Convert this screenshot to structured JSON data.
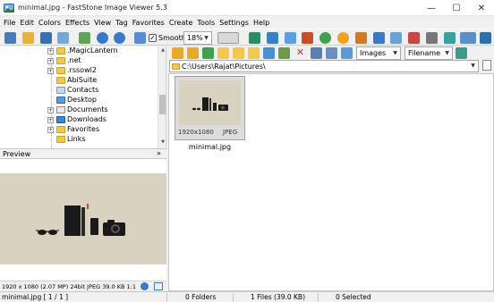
{
  "window": {
    "title": "minimal.jpg - FastStone Image Viewer 5.3",
    "minimize_glyph": "—",
    "maximize_glyph": "☐",
    "close_glyph": "✕"
  },
  "menu": [
    "File",
    "Edit",
    "Colors",
    "Effects",
    "View",
    "Tag",
    "Favorites",
    "Create",
    "Tools",
    "Settings",
    "Help"
  ],
  "toolbar": {
    "smooth_label": "Smooth",
    "smooth_checked": true,
    "zoom_value": "18%"
  },
  "tree": {
    "items": [
      {
        "label": ".MagicLantern",
        "expandable": true
      },
      {
        "label": ".net",
        "expandable": true
      },
      {
        "label": ".rssowl2",
        "expandable": true
      },
      {
        "label": "AbiSuite",
        "expandable": false
      },
      {
        "label": "Contacts",
        "expandable": false
      },
      {
        "label": "Desktop",
        "expandable": false
      },
      {
        "label": "Documents",
        "expandable": true
      },
      {
        "label": "Downloads",
        "expandable": true
      },
      {
        "label": "Favorites",
        "expandable": true
      },
      {
        "label": "Links",
        "expandable": false
      }
    ]
  },
  "preview": {
    "header": "Preview",
    "collapse_glyph": "»",
    "info": "1920 x 1080 (2.07 MP)  24bit  JPEG   39.0 KB    1:1"
  },
  "browser": {
    "filter_value": "Images",
    "sort_value": "Filename",
    "path": "C:\\Users\\Rajat\\Pictures\\",
    "thumbnails": [
      {
        "name": "minimal.jpg",
        "dims": "1920x1080",
        "type": "JPEG"
      }
    ]
  },
  "status": {
    "file": "minimal.jpg [ 1 / 1 ]",
    "folders": "0 Folders",
    "files": "1 Files (39.0 KB)",
    "selected": "0 Selected"
  },
  "colors": {
    "photo_bg": "#d8d3c0",
    "folder": "#f2c94c"
  }
}
